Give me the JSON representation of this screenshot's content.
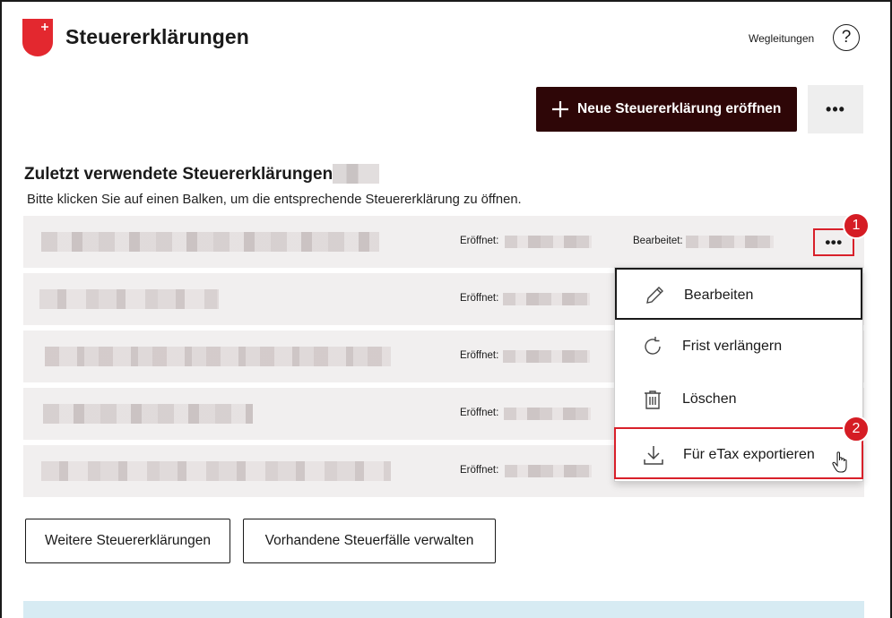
{
  "header": {
    "title": "Steuererklärungen",
    "guides_link": "Wegleitungen",
    "help_icon": "?"
  },
  "actions": {
    "new_button": "Neue Steuererklärung eröffnen",
    "more_button": "•••"
  },
  "recent": {
    "title": "Zuletzt verwendete Steuererklärungen",
    "hint": "Bitte klicken Sie auf einen Balken, um die entsprechende Steuererklärung zu öffnen.",
    "opened_label": "Eröffnet:",
    "edited_label": "Bearbeitet:",
    "row_menu": "•••"
  },
  "menu": {
    "items": [
      {
        "label": "Bearbeiten",
        "icon": "pencil-icon"
      },
      {
        "label": "Frist verlängern",
        "icon": "refresh-icon"
      },
      {
        "label": "Löschen",
        "icon": "trash-icon"
      },
      {
        "label": "Für eTax exportieren",
        "icon": "download-icon"
      }
    ]
  },
  "annotations": {
    "badge1": "1",
    "badge2": "2"
  },
  "bottom": {
    "more_returns": "Weitere Steuererklärungen",
    "manage_cases": "Vorhandene Steuerfälle verwalten"
  },
  "colors": {
    "primary": "#2e0607",
    "highlight": "#d8202a",
    "row_bg": "#f1efef",
    "info_bar": "#d7ebf3"
  }
}
